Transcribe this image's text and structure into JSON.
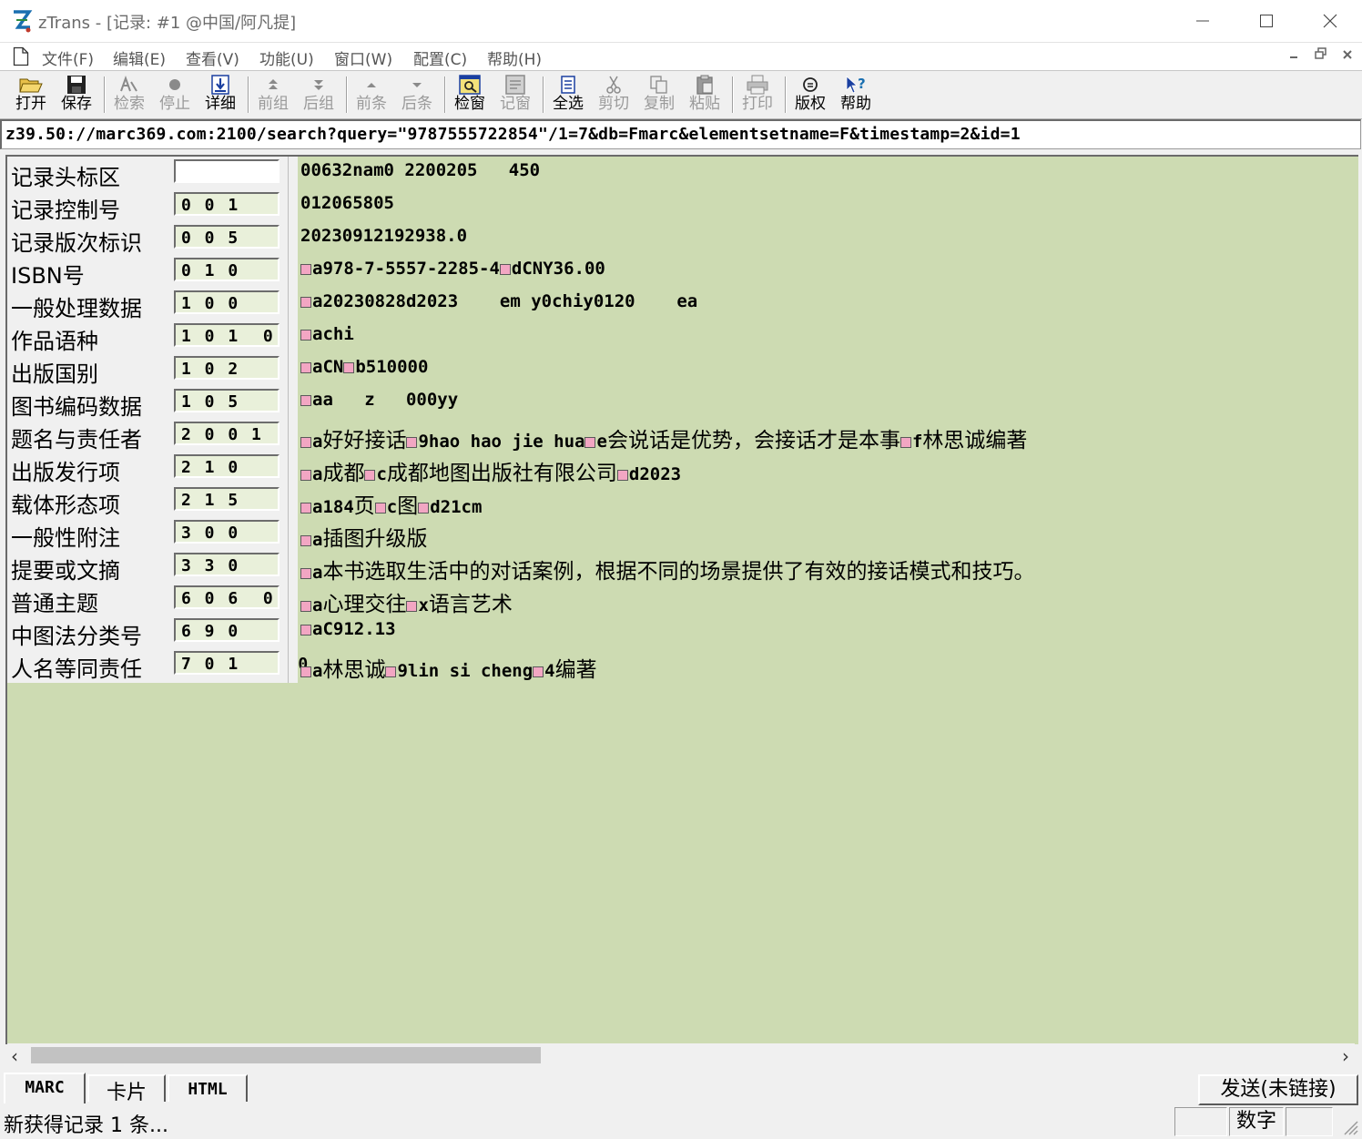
{
  "window": {
    "title": "zTrans - [记录: #1 @中国/阿凡提]"
  },
  "menu": {
    "items": [
      "文件(F)",
      "编辑(E)",
      "查看(V)",
      "功能(U)",
      "窗口(W)",
      "配置(C)",
      "帮助(H)"
    ]
  },
  "toolbar": {
    "open": "打开",
    "save": "保存",
    "search": "检索",
    "stop": "停止",
    "detail": "详细",
    "prev_group": "前组",
    "next_group": "后组",
    "prev_record": "前条",
    "next_record": "后条",
    "check": "检窗",
    "log": "记窗",
    "select_all": "全选",
    "cut": "剪切",
    "copy": "复制",
    "paste": "粘贴",
    "print": "打印",
    "copyright": "版权",
    "help": "帮助"
  },
  "url": "z39.50://marc369.com:2100/search?query=\"9787555722854\"/1=7&db=Fmarc&elementsetname=F&timestamp=2&id=1",
  "records": [
    {
      "label": "记录头标区",
      "tag": "",
      "parts": [
        {
          "t": "t",
          "v": "00632nam0 2200205   450"
        }
      ]
    },
    {
      "label": "记录控制号",
      "tag": "0 0 1",
      "parts": [
        {
          "t": "t",
          "v": "012065805"
        }
      ]
    },
    {
      "label": "记录版次标识",
      "tag": "0 0 5",
      "parts": [
        {
          "t": "t",
          "v": "20230912192938.0"
        }
      ]
    },
    {
      "label": "ISBN号",
      "tag": "0 1 0",
      "parts": [
        {
          "t": "s"
        },
        {
          "t": "t",
          "v": "a978-7-5557-2285-4"
        },
        {
          "t": "s"
        },
        {
          "t": "t",
          "v": "dCNY36.00"
        }
      ]
    },
    {
      "label": "一般处理数据",
      "tag": "1 0 0",
      "parts": [
        {
          "t": "s"
        },
        {
          "t": "t",
          "v": "a20230828d2023    em y0chiy0120    ea"
        }
      ]
    },
    {
      "label": "作品语种",
      "tag": "1 0 1  0",
      "parts": [
        {
          "t": "s"
        },
        {
          "t": "t",
          "v": "achi"
        }
      ]
    },
    {
      "label": "出版国别",
      "tag": "1 0 2",
      "parts": [
        {
          "t": "s"
        },
        {
          "t": "t",
          "v": "aCN"
        },
        {
          "t": "s"
        },
        {
          "t": "t",
          "v": "b510000"
        }
      ]
    },
    {
      "label": "图书编码数据",
      "tag": "1 0 5",
      "parts": [
        {
          "t": "s"
        },
        {
          "t": "t",
          "v": "aa   z   000yy"
        }
      ]
    },
    {
      "label": "题名与责任者",
      "tag": "2 0 0 1",
      "parts": [
        {
          "t": "s"
        },
        {
          "t": "t",
          "v": "a"
        },
        {
          "t": "c",
          "v": "好好接话"
        },
        {
          "t": "s"
        },
        {
          "t": "t",
          "v": "9hao hao jie hua"
        },
        {
          "t": "s"
        },
        {
          "t": "t",
          "v": "e"
        },
        {
          "t": "c",
          "v": "会说话是优势，会接话才是本事"
        },
        {
          "t": "s"
        },
        {
          "t": "t",
          "v": "f"
        },
        {
          "t": "c",
          "v": "林思诚编著"
        }
      ]
    },
    {
      "label": "出版发行项",
      "tag": "2 1 0",
      "parts": [
        {
          "t": "s"
        },
        {
          "t": "t",
          "v": "a"
        },
        {
          "t": "c",
          "v": "成都"
        },
        {
          "t": "s"
        },
        {
          "t": "t",
          "v": "c"
        },
        {
          "t": "c",
          "v": "成都地图出版社有限公司"
        },
        {
          "t": "s"
        },
        {
          "t": "t",
          "v": "d2023"
        }
      ]
    },
    {
      "label": "载体形态项",
      "tag": "2 1 5",
      "parts": [
        {
          "t": "s"
        },
        {
          "t": "t",
          "v": "a184"
        },
        {
          "t": "c",
          "v": "页"
        },
        {
          "t": "s"
        },
        {
          "t": "t",
          "v": "c"
        },
        {
          "t": "c",
          "v": "图"
        },
        {
          "t": "s"
        },
        {
          "t": "t",
          "v": "d21cm"
        }
      ]
    },
    {
      "label": "一般性附注",
      "tag": "3 0 0",
      "parts": [
        {
          "t": "s"
        },
        {
          "t": "t",
          "v": "a"
        },
        {
          "t": "c",
          "v": "插图升级版"
        }
      ]
    },
    {
      "label": "提要或文摘",
      "tag": "3 3 0",
      "parts": [
        {
          "t": "s"
        },
        {
          "t": "t",
          "v": "a"
        },
        {
          "t": "c",
          "v": "本书选取生活中的对话案例，根据不同的场景提供了有效的接话模式和技巧。"
        }
      ]
    },
    {
      "label": "普通主题",
      "tag": "6 0 6  0",
      "parts": [
        {
          "t": "s"
        },
        {
          "t": "t",
          "v": "a"
        },
        {
          "t": "c",
          "v": "心理交往"
        },
        {
          "t": "s"
        },
        {
          "t": "t",
          "v": "x"
        },
        {
          "t": "c",
          "v": "语言艺术"
        }
      ]
    },
    {
      "label": "中图法分类号",
      "tag": "6 9 0",
      "parts": [
        {
          "t": "s"
        },
        {
          "t": "t",
          "v": "aC912.13"
        }
      ]
    },
    {
      "label": "人名等同责任",
      "tag": "7 0 1     0",
      "parts": [
        {
          "t": "s"
        },
        {
          "t": "t",
          "v": "a"
        },
        {
          "t": "c",
          "v": "林思诚"
        },
        {
          "t": "s"
        },
        {
          "t": "t",
          "v": "9lin si cheng"
        },
        {
          "t": "s"
        },
        {
          "t": "t",
          "v": "4"
        },
        {
          "t": "c",
          "v": "编著"
        }
      ]
    }
  ],
  "tabs": {
    "marc": "MARC",
    "card": "卡片",
    "html": "HTML"
  },
  "send_button": "发送(未链接)",
  "status": {
    "message": "新获得记录 1 条...",
    "num_indicator": "数字"
  },
  "colors": {
    "content_bg": "#cddbb2",
    "subfield_marker": "#f2a6c3",
    "tag_box_bg": "#e9f0da"
  }
}
